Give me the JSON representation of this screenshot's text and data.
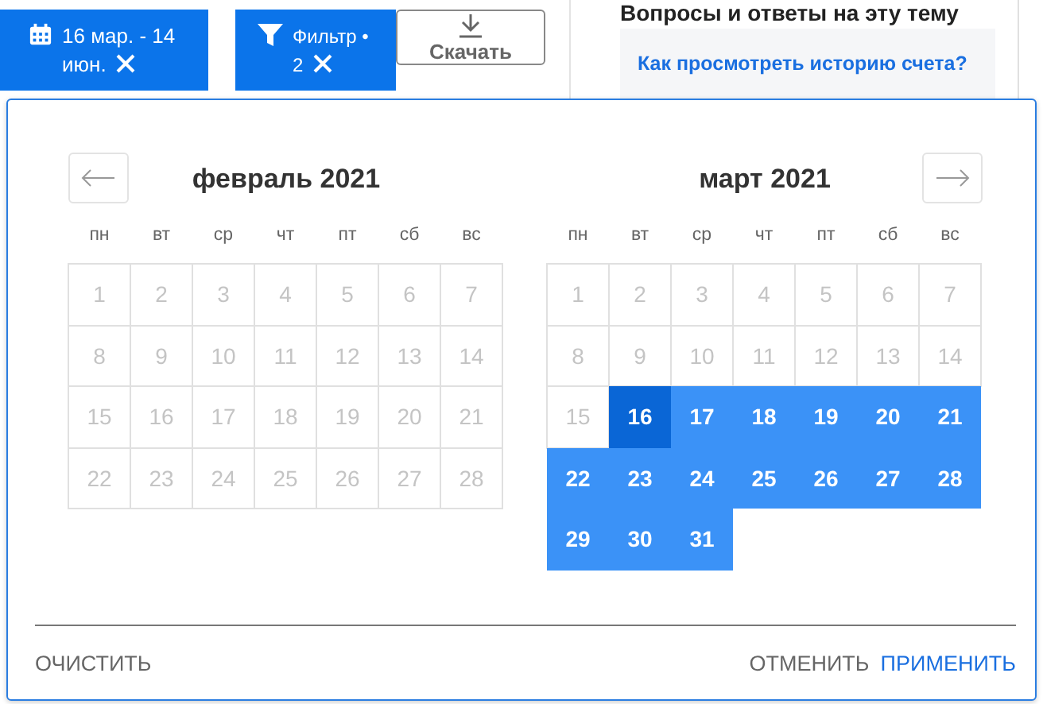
{
  "toolbar": {
    "date_chip": {
      "label": "16 мар. - 14 июн."
    },
    "filter_chip": {
      "label": "Фильтр • 2"
    },
    "download_button": {
      "label": "Скачать"
    }
  },
  "help_panel": {
    "title": "Вопросы и ответы на эту тему",
    "link": "Как просмотреть историю счета?"
  },
  "datepicker": {
    "months": [
      {
        "title": "февраль 2021",
        "prev_button": true,
        "weekdays": [
          "пн",
          "вт",
          "ср",
          "чт",
          "пт",
          "сб",
          "вс"
        ],
        "days": [
          {
            "label": "1",
            "kind": "disabled"
          },
          {
            "label": "2",
            "kind": "disabled"
          },
          {
            "label": "3",
            "kind": "disabled"
          },
          {
            "label": "4",
            "kind": "disabled"
          },
          {
            "label": "5",
            "kind": "disabled"
          },
          {
            "label": "6",
            "kind": "disabled"
          },
          {
            "label": "7",
            "kind": "disabled"
          },
          {
            "label": "8",
            "kind": "disabled"
          },
          {
            "label": "9",
            "kind": "disabled"
          },
          {
            "label": "10",
            "kind": "disabled"
          },
          {
            "label": "11",
            "kind": "disabled"
          },
          {
            "label": "12",
            "kind": "disabled"
          },
          {
            "label": "13",
            "kind": "disabled"
          },
          {
            "label": "14",
            "kind": "disabled"
          },
          {
            "label": "15",
            "kind": "disabled"
          },
          {
            "label": "16",
            "kind": "disabled"
          },
          {
            "label": "17",
            "kind": "disabled"
          },
          {
            "label": "18",
            "kind": "disabled"
          },
          {
            "label": "19",
            "kind": "disabled"
          },
          {
            "label": "20",
            "kind": "disabled"
          },
          {
            "label": "21",
            "kind": "disabled"
          },
          {
            "label": "22",
            "kind": "disabled"
          },
          {
            "label": "23",
            "kind": "disabled"
          },
          {
            "label": "24",
            "kind": "disabled"
          },
          {
            "label": "25",
            "kind": "disabled"
          },
          {
            "label": "26",
            "kind": "disabled"
          },
          {
            "label": "27",
            "kind": "disabled"
          },
          {
            "label": "28",
            "kind": "disabled"
          }
        ]
      },
      {
        "title": "март 2021",
        "next_button": true,
        "weekdays": [
          "пн",
          "вт",
          "ср",
          "чт",
          "пт",
          "сб",
          "вс"
        ],
        "days": [
          {
            "label": "1",
            "kind": "disabled"
          },
          {
            "label": "2",
            "kind": "disabled"
          },
          {
            "label": "3",
            "kind": "disabled"
          },
          {
            "label": "4",
            "kind": "disabled"
          },
          {
            "label": "5",
            "kind": "disabled"
          },
          {
            "label": "6",
            "kind": "disabled"
          },
          {
            "label": "7",
            "kind": "disabled"
          },
          {
            "label": "8",
            "kind": "disabled"
          },
          {
            "label": "9",
            "kind": "disabled"
          },
          {
            "label": "10",
            "kind": "disabled"
          },
          {
            "label": "11",
            "kind": "disabled"
          },
          {
            "label": "12",
            "kind": "disabled"
          },
          {
            "label": "13",
            "kind": "disabled"
          },
          {
            "label": "14",
            "kind": "disabled"
          },
          {
            "label": "15",
            "kind": "disabled"
          },
          {
            "label": "16",
            "kind": "range_start"
          },
          {
            "label": "17",
            "kind": "in_range"
          },
          {
            "label": "18",
            "kind": "in_range"
          },
          {
            "label": "19",
            "kind": "in_range"
          },
          {
            "label": "20",
            "kind": "in_range"
          },
          {
            "label": "21",
            "kind": "in_range"
          },
          {
            "label": "22",
            "kind": "in_range"
          },
          {
            "label": "23",
            "kind": "in_range"
          },
          {
            "label": "24",
            "kind": "in_range"
          },
          {
            "label": "25",
            "kind": "in_range"
          },
          {
            "label": "26",
            "kind": "in_range"
          },
          {
            "label": "27",
            "kind": "in_range"
          },
          {
            "label": "28",
            "kind": "in_range"
          },
          {
            "label": "29",
            "kind": "in_range"
          },
          {
            "label": "30",
            "kind": "in_range"
          },
          {
            "label": "31",
            "kind": "in_range"
          }
        ]
      }
    ],
    "footer": {
      "clear": "ОЧИСТИТЬ",
      "cancel": "ОТМЕНИТЬ",
      "apply": "ПРИМЕНИТЬ"
    }
  }
}
